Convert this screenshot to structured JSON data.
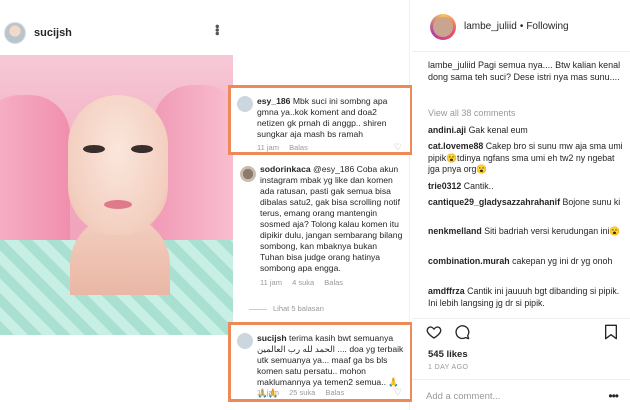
{
  "post": {
    "username": "sucijsh",
    "menu_glyph": "•••"
  },
  "comments_overlay": [
    {
      "username": "esy_186",
      "text": "Mbk suci ini sombng apa gmna ya..kok koment and doa2 netizen gk prnah di anggp.. shiren sungkar aja mash bs ramah",
      "time": "11 jam",
      "reply": "Balas"
    },
    {
      "username": "sodorinkaca",
      "text": "@esy_186 Coba akun instagram mbak yg like dan komen ada ratusan, pasti gak semua bisa dibalas satu2, gak bisa scrolling notif terus, emang orang mantengin sosmed aja? Tolong kalau komen itu dipikir dulu, jangan sembarang bilang sombong, kan mbaknya bukan Tuhan bisa judge orang hatinya sombong apa engga.",
      "time": "11 jam",
      "likes": "4 suka",
      "reply": "Balas",
      "more_replies": "Lihat 5 balasan"
    },
    {
      "username": "sucijsh",
      "text": "terima kasih bwt semuanya الحمد لله رب العالمين .... doa yg terbaik utk semuanya ya... maaf ga bs bls komen satu persatu.. mohon maklumannya ya temen2 semua.. 🙏🙏🙏",
      "time": "11 jam",
      "likes": "25 suka",
      "reply": "Balas"
    }
  ],
  "sidebar": {
    "username": "lambe_juliid",
    "separator": "•",
    "follow_status": "Following",
    "caption_user": "lambe_juliid",
    "caption": "Pagi semua nya.... Btw kalian kenal dong sama teh suci? Dese istri nya mas sunu....",
    "view_all": "View all 38 comments",
    "comments": [
      {
        "user": "andini.aji",
        "text": "Gak kenal eum"
      },
      {
        "user": "cat.loveme88",
        "text": "Cakep bro si sunu mw aja sma umi pipik😮tdinya ngfans sma umi eh tw2 ny ngebat jga pnya org😮"
      },
      {
        "user": "trie0312",
        "text": "Cantik.."
      },
      {
        "user": "cantique29_gladysazzahrahanif",
        "text": "Bojone sunu ki"
      },
      {
        "user": "nenkmelland",
        "text": "Siti badriah versi kerudungan ini😮"
      },
      {
        "user": "combination.murah",
        "text": "cakepan yg ini dr yg onoh"
      },
      {
        "user": "amdffrza",
        "text": "Cantik ini jauuuh bgt dibanding si pipik. Ini lebih langsing jg dr si pipik."
      }
    ],
    "likes": "545 likes",
    "time_ago": "1 DAY AGO",
    "add_comment_placeholder": "Add a comment...",
    "more_glyph": "•••"
  },
  "colors": {
    "highlight_border": "#ee8a58",
    "muted_text": "#999999",
    "text": "#262626"
  },
  "icons": [
    "heart-icon",
    "comment-icon",
    "bookmark-icon",
    "more-options-icon"
  ]
}
